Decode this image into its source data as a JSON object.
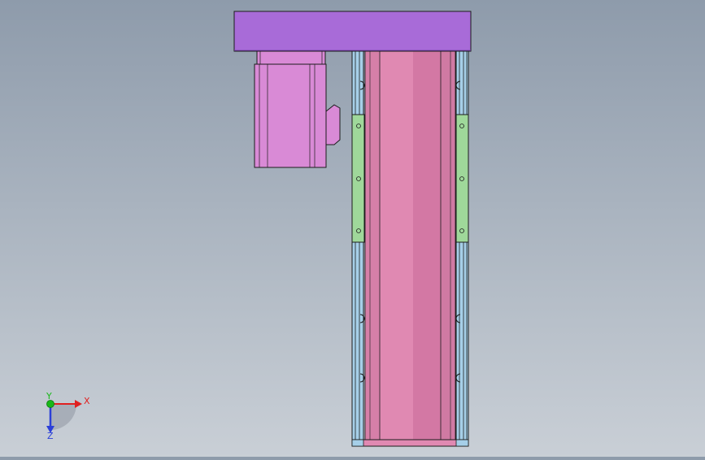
{
  "colors": {
    "background_top": "#8e9bab",
    "background_bottom": "#c9cfd6",
    "top_plate": "#a86bd8",
    "motor": "#d98ad6",
    "carriage_body": "#e089b2",
    "carriage_shade": "#c96a99",
    "rail": "#a6cfe8",
    "slider_block": "#9fd89a",
    "outline": "#1c1c1c",
    "axis_x": "#e02020",
    "axis_y": "#18b818",
    "axis_z": "#2b3fd8"
  },
  "triad": {
    "x_label": "X",
    "y_label": "Y",
    "z_label": "Z"
  }
}
